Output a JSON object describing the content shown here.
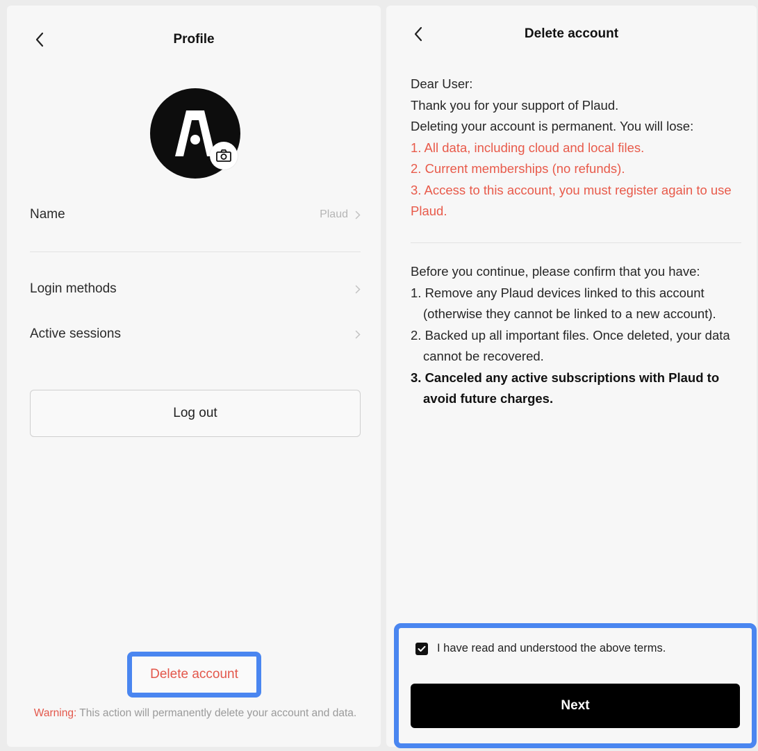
{
  "profile": {
    "title": "Profile",
    "back_icon": "chevron-left-icon",
    "avatar_icon": "plaud-logo",
    "camera_icon": "camera-icon",
    "name_label": "Name",
    "name_value": "Plaud",
    "login_methods_label": "Login methods",
    "active_sessions_label": "Active sessions",
    "logout_label": "Log out",
    "delete_account_label": "Delete account",
    "warning_label": "Warning:",
    "warning_text": "This action will permanently delete your account and data."
  },
  "delete_account": {
    "title": "Delete account",
    "back_icon": "chevron-left-icon",
    "intro_lines": [
      "Dear User:",
      "Thank you for your support of Plaud.",
      "Deleting your account is permanent. You will lose:"
    ],
    "lose_items": [
      "1. All data, including cloud and local files.",
      "2. Current memberships (no refunds).",
      "3. Access to this account, you must register again to use Plaud."
    ],
    "confirm_heading": "Before you continue, please confirm that you have:",
    "confirm_items": [
      "1. Remove any Plaud devices linked to this account (otherwise they cannot be linked to a new account).",
      "2. Backed up all important files. Once deleted, your data cannot be recovered.",
      "3. Canceled any active subscriptions with Plaud to avoid future charges."
    ],
    "checkbox_label": "I have read and understood the above terms.",
    "checkbox_checked": true,
    "next_label": "Next"
  },
  "colors": {
    "danger": "#e85a4a",
    "highlight": "#4a86f0",
    "primary_button": "#000000"
  }
}
